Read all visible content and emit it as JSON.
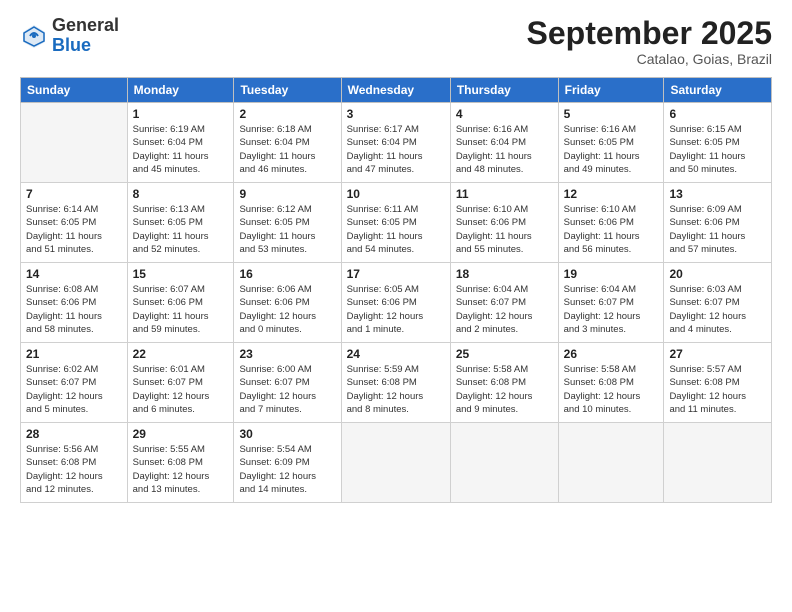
{
  "header": {
    "logo_general": "General",
    "logo_blue": "Blue",
    "month_title": "September 2025",
    "subtitle": "Catalao, Goias, Brazil"
  },
  "days_of_week": [
    "Sunday",
    "Monday",
    "Tuesday",
    "Wednesday",
    "Thursday",
    "Friday",
    "Saturday"
  ],
  "weeks": [
    [
      {
        "day": "",
        "info": ""
      },
      {
        "day": "1",
        "info": "Sunrise: 6:19 AM\nSunset: 6:04 PM\nDaylight: 11 hours\nand 45 minutes."
      },
      {
        "day": "2",
        "info": "Sunrise: 6:18 AM\nSunset: 6:04 PM\nDaylight: 11 hours\nand 46 minutes."
      },
      {
        "day": "3",
        "info": "Sunrise: 6:17 AM\nSunset: 6:04 PM\nDaylight: 11 hours\nand 47 minutes."
      },
      {
        "day": "4",
        "info": "Sunrise: 6:16 AM\nSunset: 6:04 PM\nDaylight: 11 hours\nand 48 minutes."
      },
      {
        "day": "5",
        "info": "Sunrise: 6:16 AM\nSunset: 6:05 PM\nDaylight: 11 hours\nand 49 minutes."
      },
      {
        "day": "6",
        "info": "Sunrise: 6:15 AM\nSunset: 6:05 PM\nDaylight: 11 hours\nand 50 minutes."
      }
    ],
    [
      {
        "day": "7",
        "info": "Sunrise: 6:14 AM\nSunset: 6:05 PM\nDaylight: 11 hours\nand 51 minutes."
      },
      {
        "day": "8",
        "info": "Sunrise: 6:13 AM\nSunset: 6:05 PM\nDaylight: 11 hours\nand 52 minutes."
      },
      {
        "day": "9",
        "info": "Sunrise: 6:12 AM\nSunset: 6:05 PM\nDaylight: 11 hours\nand 53 minutes."
      },
      {
        "day": "10",
        "info": "Sunrise: 6:11 AM\nSunset: 6:05 PM\nDaylight: 11 hours\nand 54 minutes."
      },
      {
        "day": "11",
        "info": "Sunrise: 6:10 AM\nSunset: 6:06 PM\nDaylight: 11 hours\nand 55 minutes."
      },
      {
        "day": "12",
        "info": "Sunrise: 6:10 AM\nSunset: 6:06 PM\nDaylight: 11 hours\nand 56 minutes."
      },
      {
        "day": "13",
        "info": "Sunrise: 6:09 AM\nSunset: 6:06 PM\nDaylight: 11 hours\nand 57 minutes."
      }
    ],
    [
      {
        "day": "14",
        "info": "Sunrise: 6:08 AM\nSunset: 6:06 PM\nDaylight: 11 hours\nand 58 minutes."
      },
      {
        "day": "15",
        "info": "Sunrise: 6:07 AM\nSunset: 6:06 PM\nDaylight: 11 hours\nand 59 minutes."
      },
      {
        "day": "16",
        "info": "Sunrise: 6:06 AM\nSunset: 6:06 PM\nDaylight: 12 hours\nand 0 minutes."
      },
      {
        "day": "17",
        "info": "Sunrise: 6:05 AM\nSunset: 6:06 PM\nDaylight: 12 hours\nand 1 minute."
      },
      {
        "day": "18",
        "info": "Sunrise: 6:04 AM\nSunset: 6:07 PM\nDaylight: 12 hours\nand 2 minutes."
      },
      {
        "day": "19",
        "info": "Sunrise: 6:04 AM\nSunset: 6:07 PM\nDaylight: 12 hours\nand 3 minutes."
      },
      {
        "day": "20",
        "info": "Sunrise: 6:03 AM\nSunset: 6:07 PM\nDaylight: 12 hours\nand 4 minutes."
      }
    ],
    [
      {
        "day": "21",
        "info": "Sunrise: 6:02 AM\nSunset: 6:07 PM\nDaylight: 12 hours\nand 5 minutes."
      },
      {
        "day": "22",
        "info": "Sunrise: 6:01 AM\nSunset: 6:07 PM\nDaylight: 12 hours\nand 6 minutes."
      },
      {
        "day": "23",
        "info": "Sunrise: 6:00 AM\nSunset: 6:07 PM\nDaylight: 12 hours\nand 7 minutes."
      },
      {
        "day": "24",
        "info": "Sunrise: 5:59 AM\nSunset: 6:08 PM\nDaylight: 12 hours\nand 8 minutes."
      },
      {
        "day": "25",
        "info": "Sunrise: 5:58 AM\nSunset: 6:08 PM\nDaylight: 12 hours\nand 9 minutes."
      },
      {
        "day": "26",
        "info": "Sunrise: 5:58 AM\nSunset: 6:08 PM\nDaylight: 12 hours\nand 10 minutes."
      },
      {
        "day": "27",
        "info": "Sunrise: 5:57 AM\nSunset: 6:08 PM\nDaylight: 12 hours\nand 11 minutes."
      }
    ],
    [
      {
        "day": "28",
        "info": "Sunrise: 5:56 AM\nSunset: 6:08 PM\nDaylight: 12 hours\nand 12 minutes."
      },
      {
        "day": "29",
        "info": "Sunrise: 5:55 AM\nSunset: 6:08 PM\nDaylight: 12 hours\nand 13 minutes."
      },
      {
        "day": "30",
        "info": "Sunrise: 5:54 AM\nSunset: 6:09 PM\nDaylight: 12 hours\nand 14 minutes."
      },
      {
        "day": "",
        "info": ""
      },
      {
        "day": "",
        "info": ""
      },
      {
        "day": "",
        "info": ""
      },
      {
        "day": "",
        "info": ""
      }
    ]
  ]
}
